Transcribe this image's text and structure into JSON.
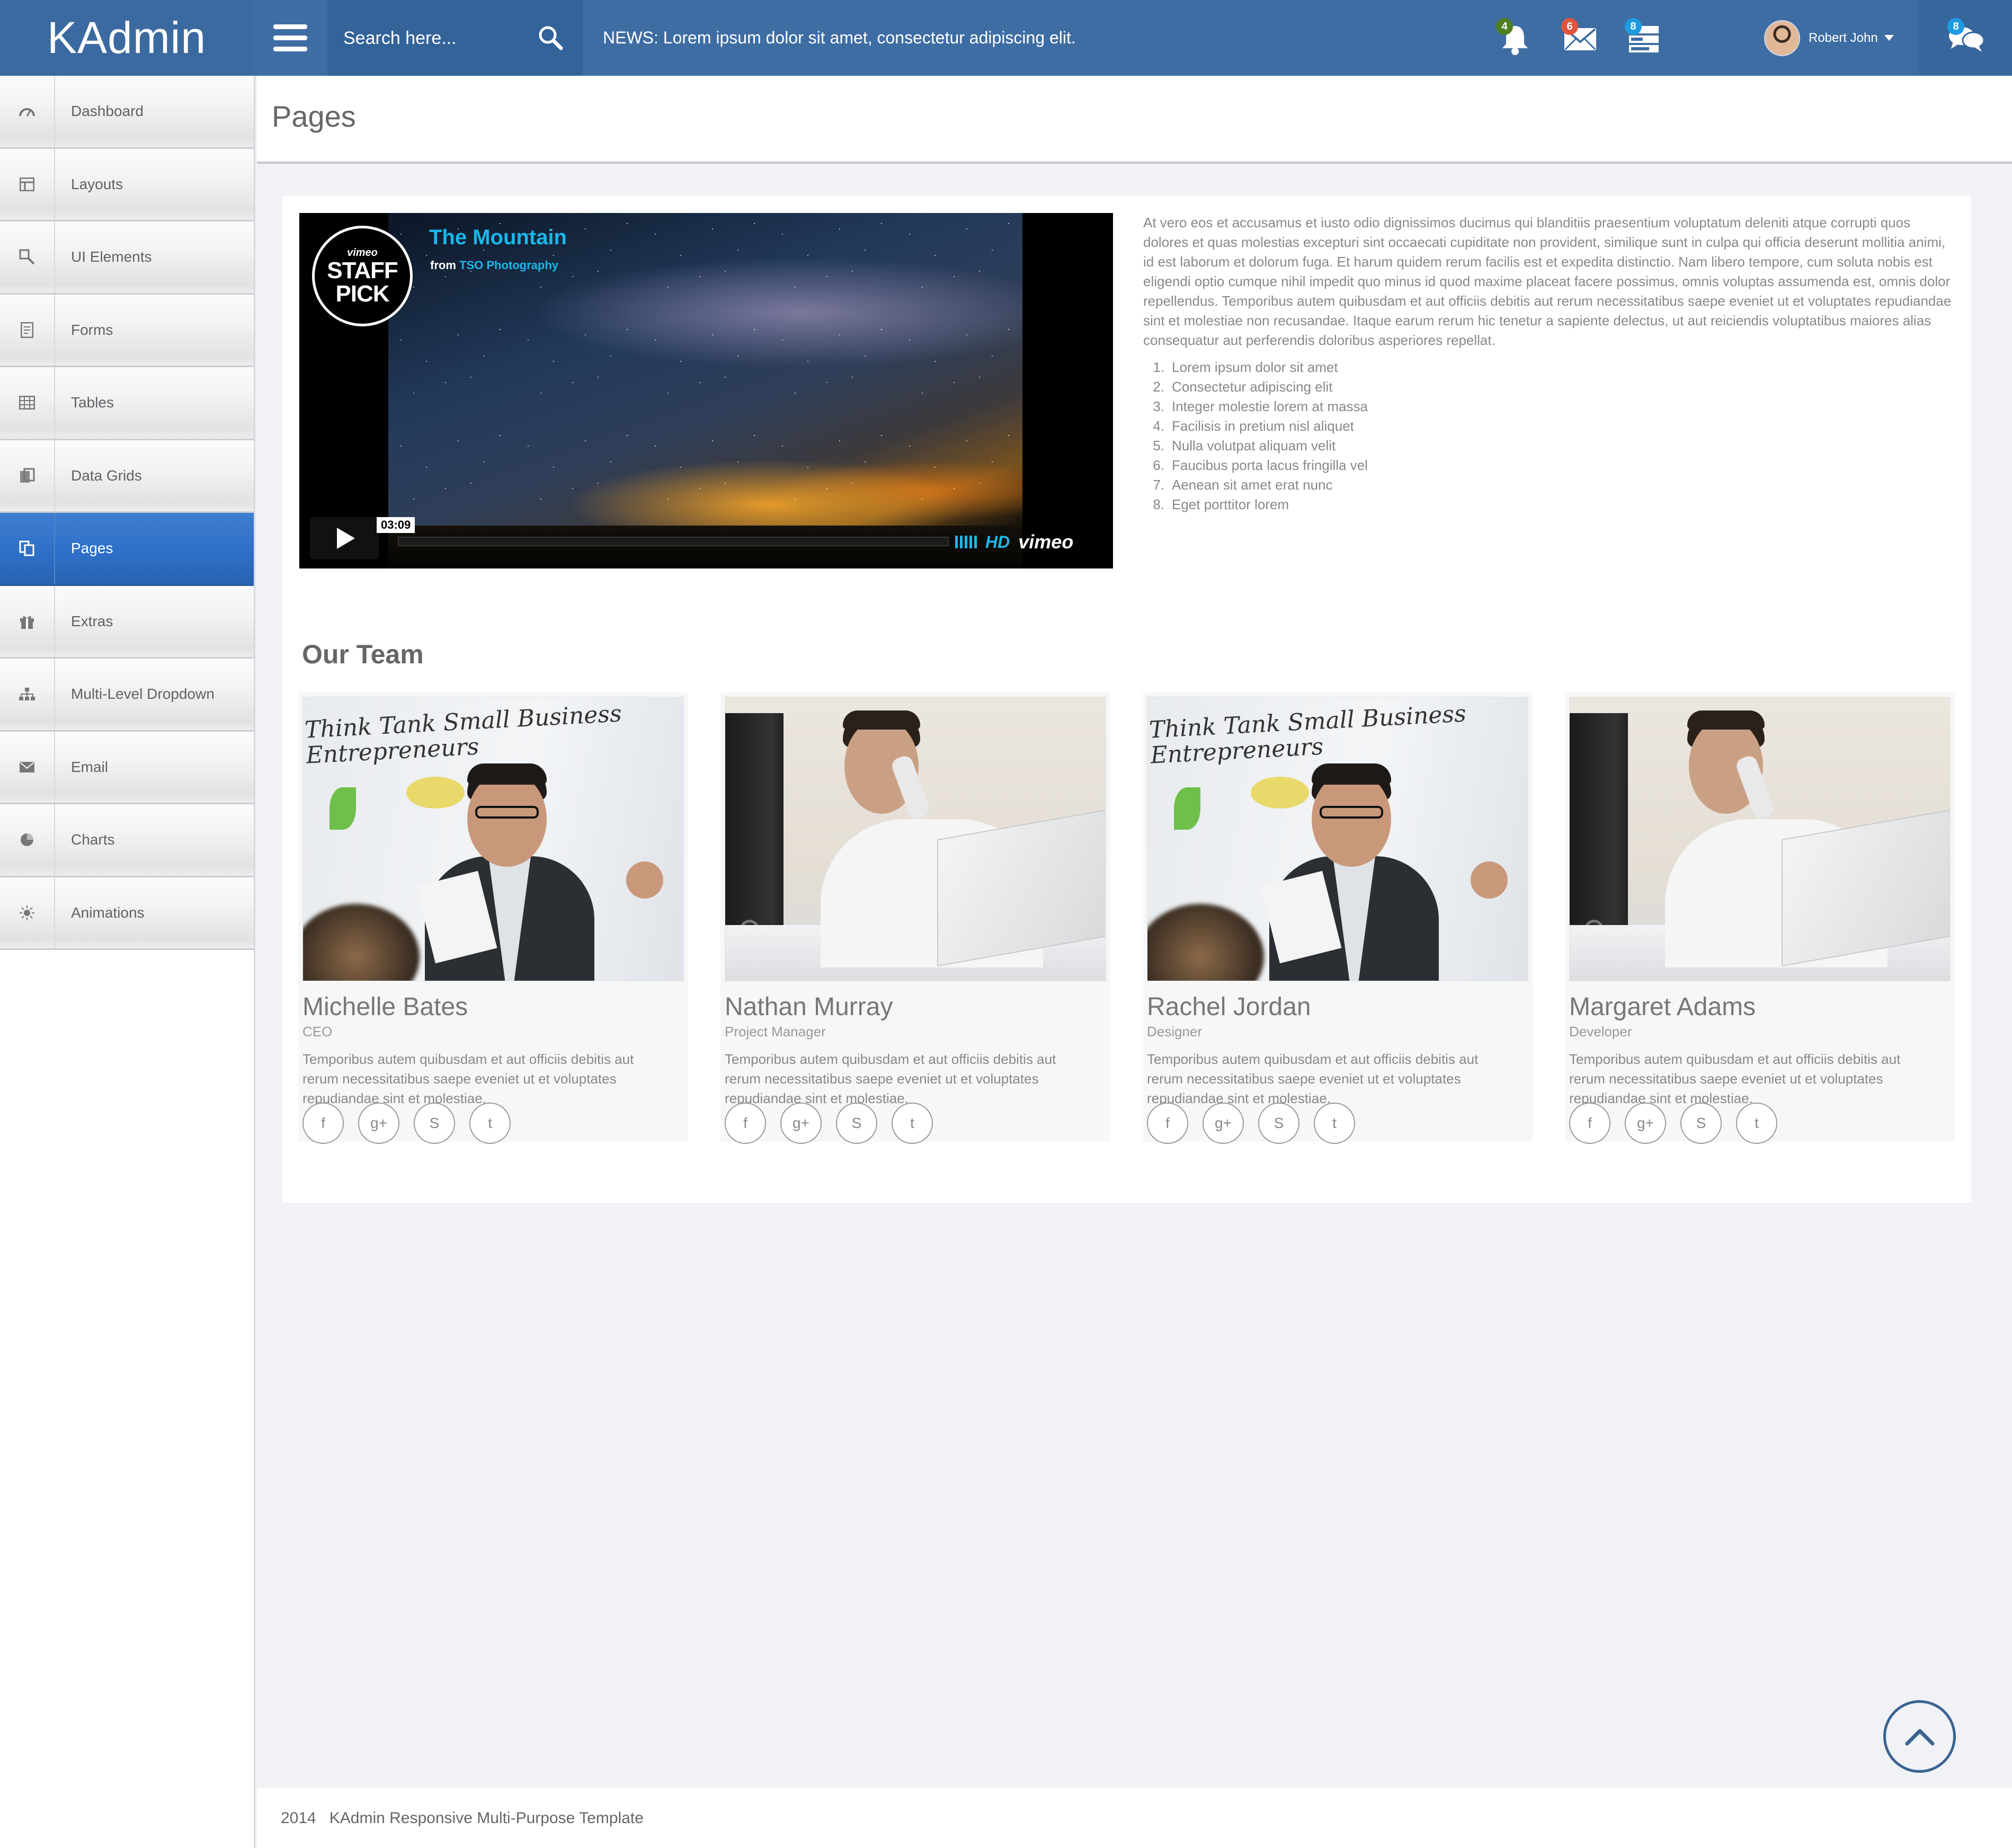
{
  "app": {
    "brand": "KAdmin"
  },
  "search": {
    "placeholder": "Search here..."
  },
  "news": "NEWS: Lorem ipsum dolor sit amet, consectetur adipiscing elit.",
  "notifications": {
    "bell": {
      "count": "4",
      "color": "#4f7f1f",
      "icon": "bell-icon"
    },
    "mail": {
      "count": "6",
      "color": "#e2543e",
      "icon": "envelope-icon"
    },
    "tasks": {
      "count": "8",
      "color": "#1d9be0",
      "icon": "tasks-icon"
    },
    "chat": {
      "count": "8",
      "color": "#1d9be0",
      "icon": "chat-icon"
    }
  },
  "user": {
    "name": "Robert John"
  },
  "sidebar": {
    "active": "Pages",
    "items": [
      {
        "label": "Dashboard",
        "icon": "dashboard-icon"
      },
      {
        "label": "Layouts",
        "icon": "layouts-icon"
      },
      {
        "label": "UI Elements",
        "icon": "ui-elements-icon"
      },
      {
        "label": "Forms",
        "icon": "forms-icon"
      },
      {
        "label": "Tables",
        "icon": "tables-icon"
      },
      {
        "label": "Data Grids",
        "icon": "data-grids-icon"
      },
      {
        "label": "Pages",
        "icon": "pages-icon"
      },
      {
        "label": "Extras",
        "icon": "gift-icon"
      },
      {
        "label": "Multi-Level Dropdown",
        "icon": "sitemap-icon"
      },
      {
        "label": "Email",
        "icon": "envelope-icon"
      },
      {
        "label": "Charts",
        "icon": "pie-chart-icon"
      },
      {
        "label": "Animations",
        "icon": "sun-icon"
      }
    ]
  },
  "page": {
    "title": "Pages"
  },
  "video": {
    "badge_top": "vimeo",
    "badge_line1": "STAFF",
    "badge_line2": "PICK",
    "title": "The Mountain",
    "from_prefix": "from",
    "from_author": "TSO Photography",
    "duration": "03:09",
    "hd_label": "HD",
    "logo": "vimeo"
  },
  "intro_text": "At vero eos et accusamus et iusto odio dignissimos ducimus qui blanditiis praesentium voluptatum deleniti atque corrupti quos dolores et quas molestias excepturi sint occaecati cupiditate non provident, similique sunt in culpa qui officia deserunt mollitia animi, id est laborum et dolorum fuga. Et harum quidem rerum facilis est et expedita distinctio. Nam libero tempore, cum soluta nobis est eligendi optio cumque nihil impedit quo minus id quod maxime placeat facere possimus, omnis voluptas assumenda est, omnis dolor repellendus. Temporibus autem quibusdam et aut officiis debitis aut rerum necessitatibus saepe eveniet ut et voluptates repudiandae sint et molestiae non recusandae. Itaque earum rerum hic tenetur a sapiente delectus, ut aut reiciendis voluptatibus maiores alias consequatur aut perferendis doloribus asperiores repellat.",
  "steps": [
    "Lorem ipsum dolor sit amet",
    "Consectetur adipiscing elit",
    "Integer molestie lorem at massa",
    "Facilisis in pretium nisl aliquet",
    "Nulla volutpat aliquam velit",
    "Faucibus porta lacus fringilla vel",
    "Aenean sit amet erat nunc",
    "Eget porttitor lorem"
  ],
  "team": {
    "title": "Our Team",
    "members": [
      {
        "name": "Michelle Bates",
        "role": "CEO",
        "bio": "Temporibus autem quibusdam et aut officiis debitis aut rerum necessitatibus saepe eveniet ut et voluptates repudiandae sint et molestiae."
      },
      {
        "name": "Nathan Murray",
        "role": "Project Manager",
        "bio": "Temporibus autem quibusdam et aut officiis debitis aut rerum necessitatibus saepe eveniet ut et voluptates repudiandae sint et molestiae."
      },
      {
        "name": "Rachel Jordan",
        "role": "Designer",
        "bio": "Temporibus autem quibusdam et aut officiis debitis aut rerum necessitatibus saepe eveniet ut et voluptates repudiandae sint et molestiae."
      },
      {
        "name": "Margaret Adams",
        "role": "Developer",
        "bio": "Temporibus autem quibusdam et aut officiis debitis aut rerum necessitatibus saepe eveniet ut et voluptates repudiandae sint et molestiae."
      }
    ],
    "board_text": "Think Tank Small Business Entrepreneurs",
    "social": [
      {
        "glyph": "f",
        "icon": "facebook-icon"
      },
      {
        "glyph": "g+",
        "icon": "google-plus-icon"
      },
      {
        "glyph": "S",
        "icon": "skype-icon"
      },
      {
        "glyph": "t",
        "icon": "twitter-icon"
      }
    ]
  },
  "footer": {
    "year": "2014",
    "text": "KAdmin Responsive Multi-Purpose Template"
  }
}
